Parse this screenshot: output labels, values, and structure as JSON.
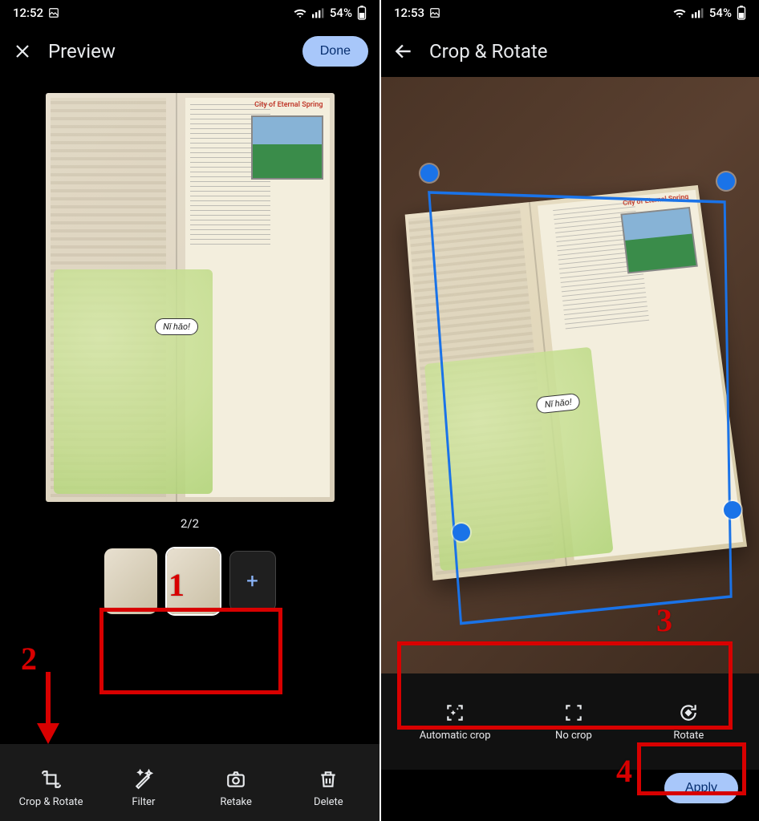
{
  "left": {
    "status": {
      "time": "12:52",
      "battery": "54%"
    },
    "header": {
      "title": "Preview",
      "done": "Done"
    },
    "page_label": "2/2",
    "thumb_add": "+",
    "book": {
      "title": "City of Eternal Spring",
      "bubble": "Nǐ hǎo!"
    },
    "actions": {
      "crop": "Crop & Rotate",
      "filter": "Filter",
      "retake": "Retake",
      "delete": "Delete"
    }
  },
  "right": {
    "status": {
      "time": "12:53",
      "battery": "54%"
    },
    "header": {
      "title": "Crop & Rotate"
    },
    "book": {
      "title": "City of Eternal Spring",
      "bubble": "Nǐ hǎo!"
    },
    "actions": {
      "auto": "Automatic crop",
      "none": "No crop",
      "rotate": "Rotate"
    },
    "apply": "Apply"
  },
  "annotations": {
    "n1": "1",
    "n2": "2",
    "n3": "3",
    "n4": "4"
  }
}
